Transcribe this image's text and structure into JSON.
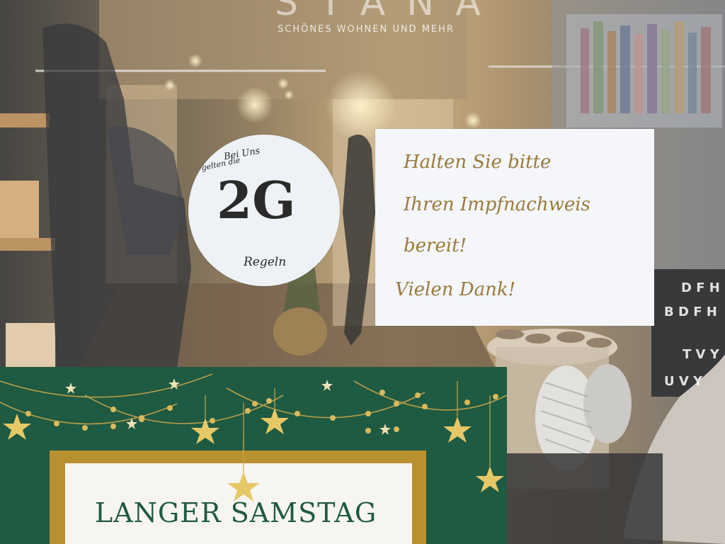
{
  "storefront": {
    "logo_text": "STANA",
    "tagline": "SCHÖNES WOHNEN UND MEHR"
  },
  "circle_sign": {
    "line1": "Bei Uns",
    "line2": "gelten die",
    "big": "2G",
    "bottom": "Regeln"
  },
  "note_sign": {
    "line1": "Halten Sie bitte",
    "line2": "Ihren Impfnachweis",
    "line3": "bereit!",
    "line4": "Vielen Dank!"
  },
  "poster": {
    "title": "LANGER SAMSTAG"
  },
  "letter_boxes": {
    "row1": "D F H",
    "row2": "B D F H",
    "row3": "T V Y",
    "row4": "U V Y"
  },
  "colors": {
    "poster_green": "#1f5a42",
    "gold": "#b8902e",
    "note_ink": "#9b7a3a"
  }
}
